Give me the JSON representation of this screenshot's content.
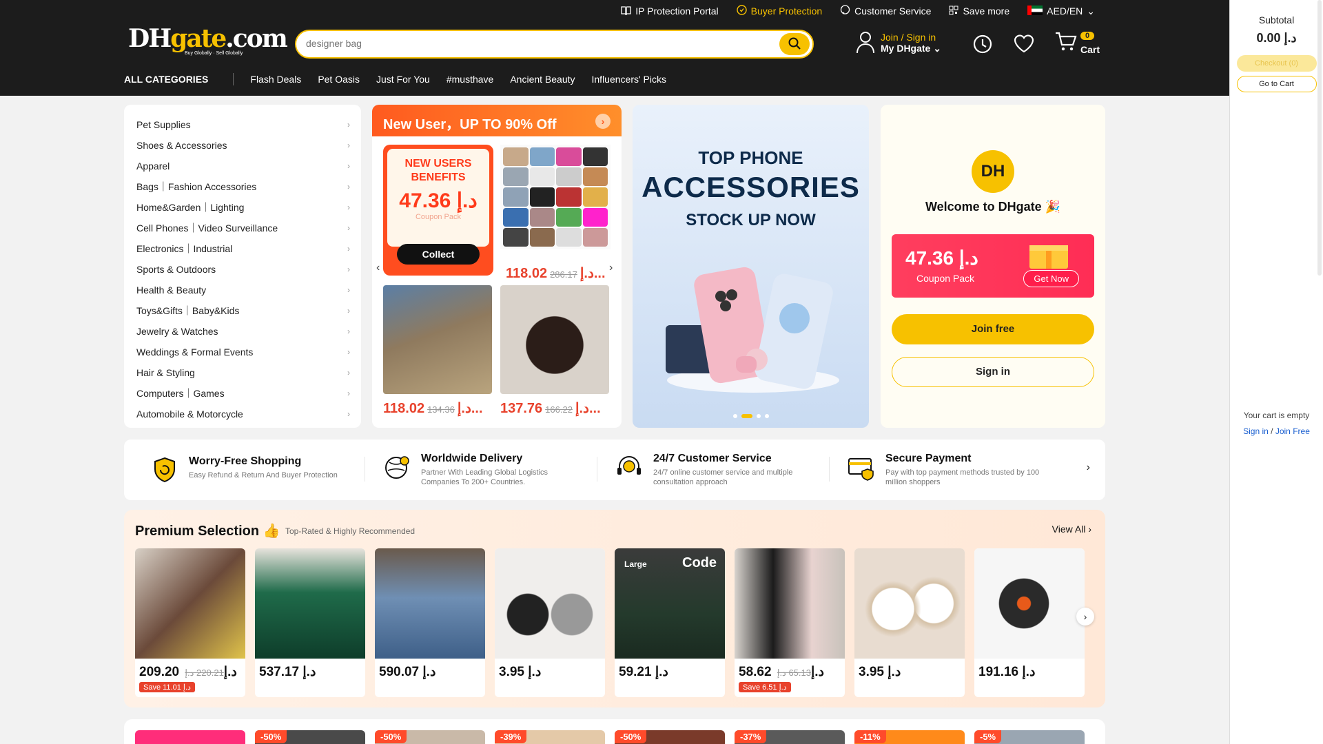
{
  "topnav": {
    "ip": "IP Protection Portal",
    "buyer": "Buyer Protection",
    "service": "Customer Service",
    "save": "Save more",
    "locale": "AED/EN"
  },
  "logo": {
    "main_a": "DH",
    "main_b": "gate",
    "main_c": ".com",
    "tagline": "Buy Globally · Sell Globally"
  },
  "search": {
    "placeholder": "designer bag"
  },
  "account": {
    "join": "Join / Sign in",
    "my": "My DHgate"
  },
  "cart": {
    "count": "0",
    "label": "Cart"
  },
  "catbar": {
    "all": "ALL CATEGORIES",
    "items": [
      "Flash Deals",
      "Pet Oasis",
      "Just For You",
      "#musthave",
      "Ancient Beauty",
      "Influencers' Picks"
    ]
  },
  "categories": [
    "Pet Supplies",
    "Shoes & Accessories",
    "Apparel",
    "Bags｜Fashion Accessories",
    "Home&Garden｜Lighting",
    "Cell Phones｜Video Surveillance",
    "Electronics｜Industrial",
    "Sports & Outdoors",
    "Health & Beauty",
    "Toys&Gifts｜Baby&Kids",
    "Jewelry & Watches",
    "Weddings & Formal Events",
    "Hair & Styling",
    "Computers｜Games",
    "Automobile & Motorcycle"
  ],
  "promo": {
    "title": "New User，UP TO 90% Off",
    "coupon_title": "NEW USERS BENEFITS",
    "coupon_amount": "47.36 د.إ",
    "coupon_sub": "Coupon Pack",
    "collect": "Collect",
    "prices": [
      {
        "now": "118.02",
        "was": "286.17",
        "cur": "د.إ..."
      },
      {
        "now": "118.02",
        "was": "134.36",
        "cur": "د.إ..."
      },
      {
        "now": "137.76",
        "was": "166.22",
        "cur": "د.إ..."
      }
    ]
  },
  "banner": {
    "l1": "TOP PHONE",
    "l2": "ACCESSORIES",
    "l3": "STOCK UP NOW"
  },
  "welcome": {
    "logo": "DH",
    "text": "Welcome to DHgate 🎉",
    "coupon_amount": "47.36 د.إ",
    "coupon_sub": "Coupon Pack",
    "get_now": "Get Now",
    "join": "Join free",
    "sign": "Sign in"
  },
  "features": [
    {
      "title": "Worry-Free Shopping",
      "desc": "Easy Refund & Return And Buyer Protection"
    },
    {
      "title": "Worldwide Delivery",
      "desc": "Partner With Leading Global Logistics Companies To 200+ Countries."
    },
    {
      "title": "24/7 Customer Service",
      "desc": "24/7 online customer service and multiple consultation approach"
    },
    {
      "title": "Secure Payment",
      "desc": "Pay with top payment methods trusted by 100 million shoppers"
    }
  ],
  "premium": {
    "title": "Premium Selection",
    "subtitle": "Top-Rated & Highly Recommended",
    "view_all": "View All",
    "products": [
      {
        "price": "209.20 د.إ",
        "was": "220.21 د.إ",
        "save": "Save 11.01 د.إ",
        "color": "#c9b8a6"
      },
      {
        "price": "537.17 د.إ",
        "was": "",
        "save": "",
        "color": "#1f6b4a"
      },
      {
        "price": "590.07 د.إ",
        "was": "",
        "save": "",
        "color": "#6f8fb4"
      },
      {
        "price": "3.95 د.إ",
        "was": "",
        "save": "",
        "color": "#d9d4cf"
      },
      {
        "price": "59.21 د.إ",
        "was": "",
        "save": "",
        "color": "#243a2c"
      },
      {
        "price": "58.62 د.إ",
        "was": "65.13 د.إ",
        "save": "Save 6.51 د.إ",
        "color": "#b9b2ab"
      },
      {
        "price": "3.95 د.إ",
        "was": "",
        "save": "",
        "color": "#e8dcd0"
      },
      {
        "price": "191.16 د.إ",
        "was": "",
        "save": "",
        "color": "#f2f2f2"
      }
    ],
    "badge_code": "Code",
    "badge_large": "Large"
  },
  "deals": [
    "-50%",
    "-50%",
    "-39%",
    "-50%",
    "-37%",
    "-11%",
    "-5%"
  ],
  "cartside": {
    "subtotal": "Subtotal",
    "value": "0.00 د.إ",
    "checkout": "Checkout (0)",
    "go": "Go to Cart",
    "empty": "Your cart is empty",
    "sign": "Sign in",
    "sep": " / ",
    "join": "Join Free"
  }
}
